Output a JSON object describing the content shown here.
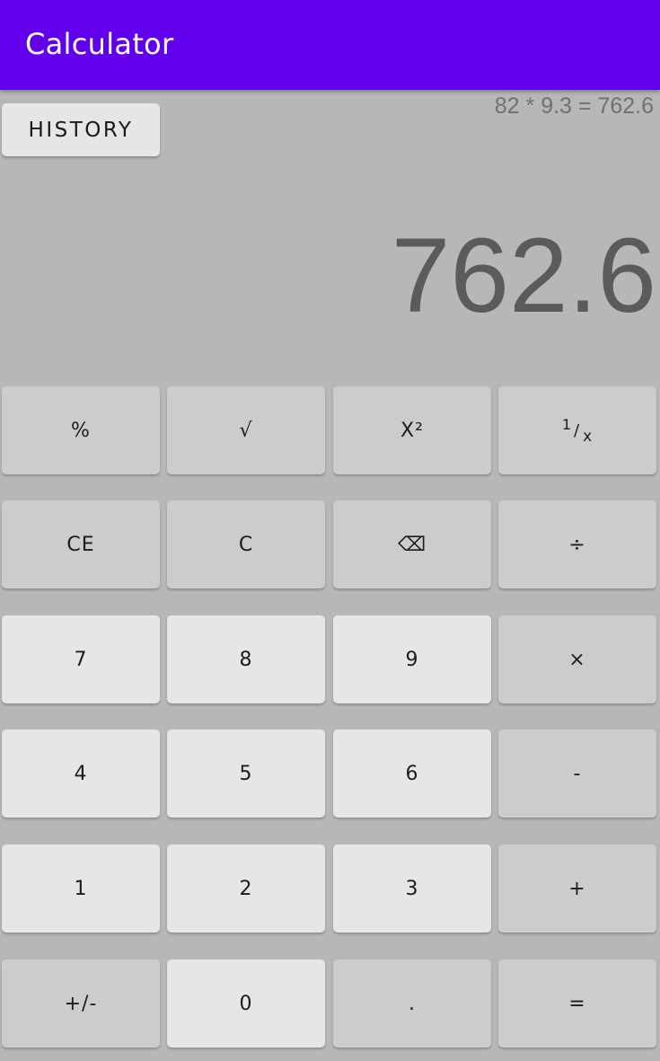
{
  "appbar": {
    "title": "Calculator",
    "color": "#6200ee"
  },
  "history_button": {
    "label": "HISTORY"
  },
  "expression": "82 * 9.3 = 762.6",
  "display_value": "762.6",
  "keys": {
    "percent": "%",
    "sqrt": "√",
    "square": "X²",
    "reciprocal": {
      "numerator": "1",
      "slash": "/",
      "denominator": "x"
    },
    "ce": "CE",
    "c": "C",
    "backspace": "⌫",
    "divide": "÷",
    "seven": "7",
    "eight": "8",
    "nine": "9",
    "multiply": "×",
    "four": "4",
    "five": "5",
    "six": "6",
    "minus": "-",
    "one": "1",
    "two": "2",
    "three": "3",
    "plus": "+",
    "negate": "+/-",
    "zero": "0",
    "decimal": ".",
    "equals": "="
  },
  "colors": {
    "background": "#b7b7b7",
    "key_light": "#e6e6e6",
    "key_dark": "#cccccc"
  }
}
